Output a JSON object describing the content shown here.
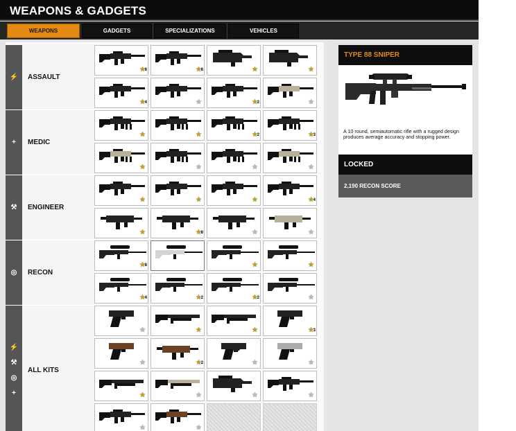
{
  "title": "WEAPONS & GADGETS",
  "tabs": [
    {
      "label": "WEAPONS",
      "active": true
    },
    {
      "label": "GADGETS",
      "active": false
    },
    {
      "label": "SPECIALIZATIONS",
      "active": false
    },
    {
      "label": "VEHICLES",
      "active": false
    }
  ],
  "kits": [
    {
      "name": "ASSAULT",
      "icons": [
        "assault-icon"
      ],
      "weapons": [
        {
          "type": "assault-rifle",
          "star": "gold",
          "rank": "8"
        },
        {
          "type": "assault-rifle",
          "star": "gold",
          "rank": "8"
        },
        {
          "type": "bullpup",
          "star": "gold",
          "rank": ""
        },
        {
          "type": "bullpup",
          "star": "gold",
          "rank": ""
        },
        {
          "type": "assault-rifle",
          "star": "gold",
          "rank": "4"
        },
        {
          "type": "assault-rifle",
          "star": "dim",
          "rank": ""
        },
        {
          "type": "assault-rifle",
          "star": "gold",
          "rank": "2"
        },
        {
          "type": "assault-rifle-camo",
          "star": "dim",
          "rank": ""
        }
      ]
    },
    {
      "name": "MEDIC",
      "icons": [
        "medic-icon"
      ],
      "weapons": [
        {
          "type": "lmg",
          "star": "gold",
          "rank": ""
        },
        {
          "type": "lmg",
          "star": "gold",
          "rank": ""
        },
        {
          "type": "lmg",
          "star": "gold",
          "rank": "2"
        },
        {
          "type": "lmg",
          "star": "gold",
          "rank": "3"
        },
        {
          "type": "lmg-camo",
          "star": "gold",
          "rank": ""
        },
        {
          "type": "lmg",
          "star": "dim",
          "rank": ""
        },
        {
          "type": "lmg",
          "star": "dim",
          "rank": ""
        },
        {
          "type": "lmg-camo",
          "star": "dim",
          "rank": ""
        }
      ]
    },
    {
      "name": "ENGINEER",
      "icons": [
        "engineer-icon"
      ],
      "weapons": [
        {
          "type": "carbine",
          "star": "gold",
          "rank": ""
        },
        {
          "type": "carbine",
          "star": "gold",
          "rank": ""
        },
        {
          "type": "carbine",
          "star": "gold",
          "rank": ""
        },
        {
          "type": "carbine",
          "star": "gold",
          "rank": "4"
        },
        {
          "type": "smg",
          "star": "gold",
          "rank": ""
        },
        {
          "type": "smg",
          "star": "gold",
          "rank": "8"
        },
        {
          "type": "smg",
          "star": "dim",
          "rank": ""
        },
        {
          "type": "smg-camo",
          "star": "dim",
          "rank": ""
        }
      ]
    },
    {
      "name": "RECON",
      "icons": [
        "recon-icon"
      ],
      "weapons": [
        {
          "type": "sniper",
          "star": "gold",
          "rank": "8"
        },
        {
          "type": "sniper-ghost",
          "star": "none",
          "rank": ""
        },
        {
          "type": "sniper",
          "star": "gold",
          "rank": ""
        },
        {
          "type": "sniper",
          "star": "gold",
          "rank": ""
        },
        {
          "type": "sniper",
          "star": "gold",
          "rank": "4"
        },
        {
          "type": "sniper",
          "star": "gold",
          "rank": "2"
        },
        {
          "type": "sniper",
          "star": "gold",
          "rank": "2"
        },
        {
          "type": "sniper",
          "star": "dim",
          "rank": ""
        }
      ]
    },
    {
      "name": "ALL KITS",
      "icons": [
        "assault-icon",
        "engineer-icon",
        "recon-icon",
        "medic-icon"
      ],
      "weapons": [
        {
          "type": "pistol",
          "star": "dim",
          "rank": ""
        },
        {
          "type": "shotgun",
          "star": "gold",
          "rank": ""
        },
        {
          "type": "shotgun",
          "star": "gold",
          "rank": ""
        },
        {
          "type": "pistol",
          "star": "gold",
          "rank": "3"
        },
        {
          "type": "pistol-wood",
          "star": "dim",
          "rank": ""
        },
        {
          "type": "smg-wood",
          "star": "gold",
          "rank": "2"
        },
        {
          "type": "revolver",
          "star": "dim",
          "rank": ""
        },
        {
          "type": "pistol-chrome",
          "star": "dim",
          "rank": ""
        },
        {
          "type": "shotgun",
          "star": "gold",
          "rank": ""
        },
        {
          "type": "shotgun-camo",
          "star": "dim",
          "rank": ""
        },
        {
          "type": "bullpup",
          "star": "dim",
          "rank": ""
        },
        {
          "type": "carbine",
          "star": "dim",
          "rank": ""
        },
        {
          "type": "carbine",
          "star": "dim",
          "rank": ""
        },
        {
          "type": "rifle-wood",
          "star": "dim",
          "rank": ""
        },
        {
          "type": "empty",
          "star": "none",
          "rank": ""
        },
        {
          "type": "empty",
          "star": "none",
          "rank": ""
        }
      ]
    }
  ],
  "details": {
    "weapon_name": "TYPE 88 SNIPER",
    "description": "A 10 round, semiautomatic rifle with a rugged design produces average accuracy and stopping power.",
    "status": "LOCKED",
    "requirement": "2,190 RECON SCORE"
  },
  "colors": {
    "accent": "#e48a12",
    "header_bg": "#0c0c0c",
    "kit_bar": "#555555",
    "star_gold": "#caa112"
  }
}
